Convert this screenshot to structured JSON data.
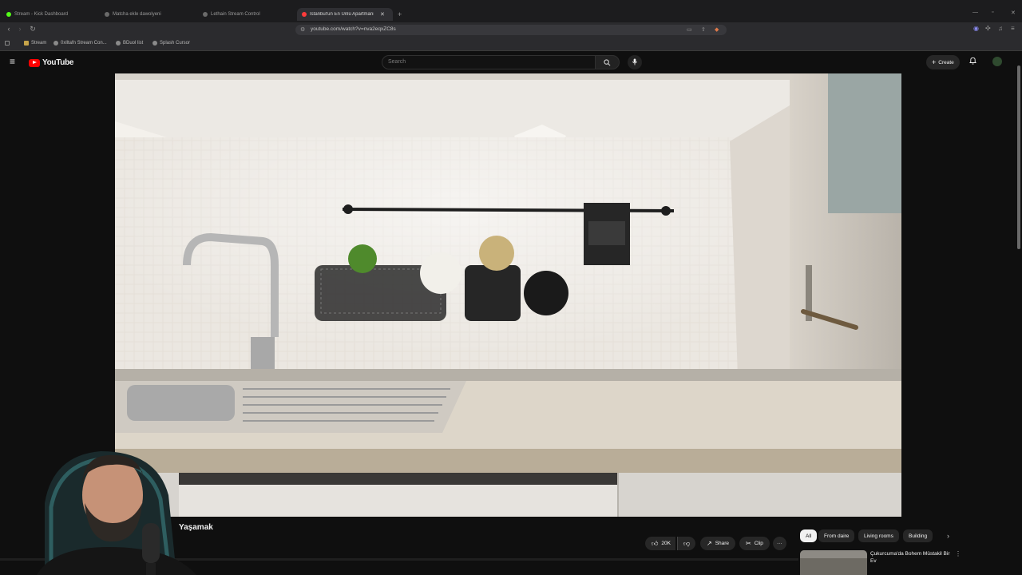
{
  "browser": {
    "tabs": [
      {
        "label": "Stream - Kick Dashboard",
        "active": false
      },
      {
        "label": "Matcha ekle dawolyeni",
        "active": false
      },
      {
        "label": "Lethain Stream Control",
        "active": false
      },
      {
        "label": "İstanbul'un En Ünlü Apartmanı",
        "active": true
      }
    ],
    "new_tab": "+",
    "url": "youtube.com/watch?v=nva2eqxZC8s",
    "bookmarks": [
      "Stream",
      "0xlltafn Stream Con...",
      "BDuol list",
      "Splash Cursor"
    ]
  },
  "youtube": {
    "logo_text": "YouTube",
    "search_placeholder": "Search",
    "create_label": "Create"
  },
  "video": {
    "title": "Yaşamak",
    "like_count": "20K",
    "share_label": "Share",
    "clip_label": "Clip",
    "more_label": "···"
  },
  "chips": [
    "All",
    "From daire",
    "Living rooms",
    "Building"
  ],
  "recommendation": {
    "title": "Çukurcuma'da Bohem Müstakil Bir Ev"
  },
  "colors": {
    "youtube_red": "#ff0000",
    "background": "#0f0f0f",
    "chip_selected": "#f1f1f1"
  }
}
